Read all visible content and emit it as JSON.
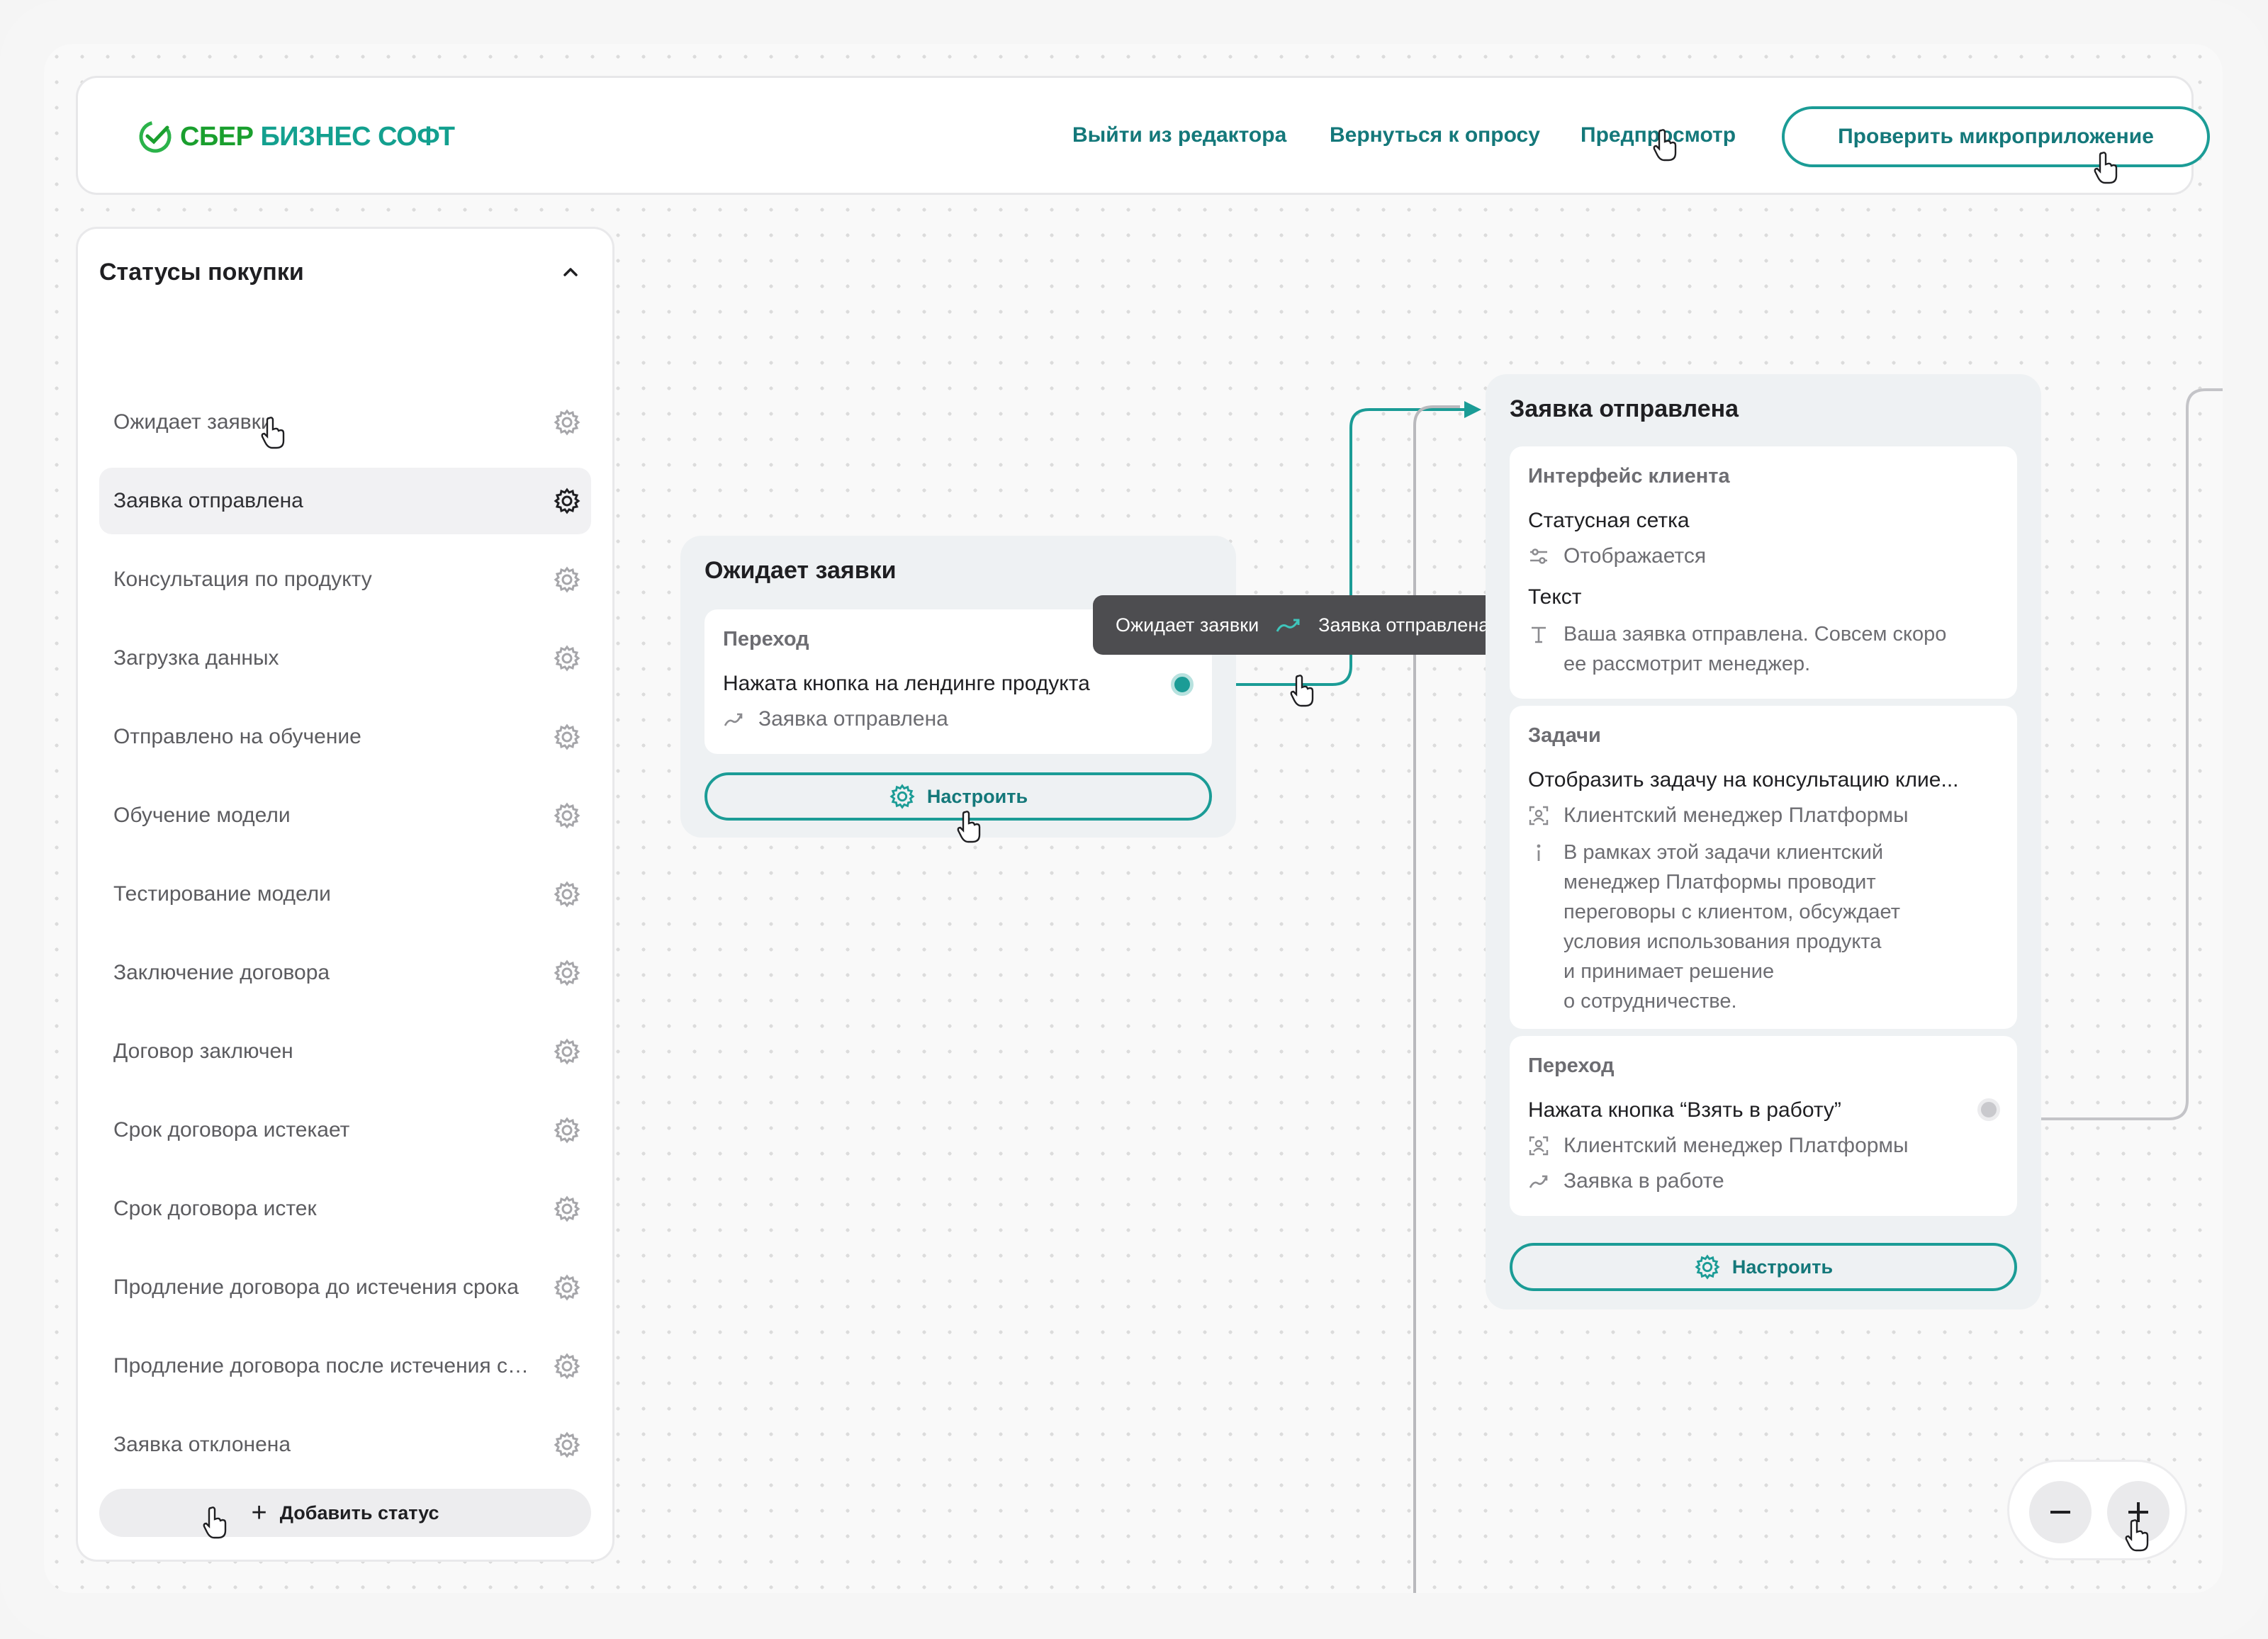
{
  "header": {
    "logo_part1": "СБЕР",
    "logo_part2": "БИЗНЕС СОФТ",
    "nav": [
      "Выйти из редактора",
      "Вернуться к опросу",
      "Предпросмотр"
    ],
    "check_button": "Проверить микроприложение"
  },
  "sidebar": {
    "title": "Статусы покупки",
    "items": [
      "Ожидает заявки",
      "Заявка отправлена",
      "Консультация по продукту",
      "Загрузка данных",
      "Отправлено на обучение",
      "Обучение модели",
      "Тестирование модели",
      "Заключение договора",
      "Договор заключен",
      "Срок договора истекает",
      "Срок договора истек",
      "Продление договора до истечения срока",
      "Продление договора после истечения срока",
      "Заявка отклонена"
    ],
    "add_button": "Добавить статус"
  },
  "card_waiting": {
    "title": "Ожидает заявки",
    "section_head": "Переход",
    "trigger": "Нажата кнопка на лендинге продукта",
    "target": "Заявка отправлена",
    "configure": "Настроить"
  },
  "tooltip": {
    "from": "Ожидает заявки",
    "to": "Заявка отправлена"
  },
  "card_sent": {
    "title": "Заявка отправлена",
    "ui_head": "Интерфейс клиента",
    "grid_label": "Статусная сетка",
    "grid_value": "Отображается",
    "text_label": "Текст",
    "text_line1": "Ваша заявка отправлена. Совсем скоро",
    "text_line2": "ее рассмотрит менеджер.",
    "tasks_head": "Задачи",
    "task_title": "Отобразить задачу на консультацию клие...",
    "task_role": "Клиентский менеджер Платформы",
    "task_desc": [
      "В рамках этой задачи клиентский",
      "менеджер Платформы проводит",
      "переговоры с клиентом, обсуждает",
      "условия использования продукта",
      "и принимает решение",
      "о сотрудничестве."
    ],
    "transition_head": "Переход",
    "transition_trigger": "Нажата кнопка “Взять в работу”",
    "transition_role": "Клиентский менеджер Платформы",
    "transition_target": "Заявка в работе",
    "configure": "Настроить"
  },
  "colors": {
    "accent": "#1b9c96",
    "accent_text": "#14787a",
    "logo_green": "#1a9f2e",
    "tooltip_bg": "#4d4d50"
  }
}
